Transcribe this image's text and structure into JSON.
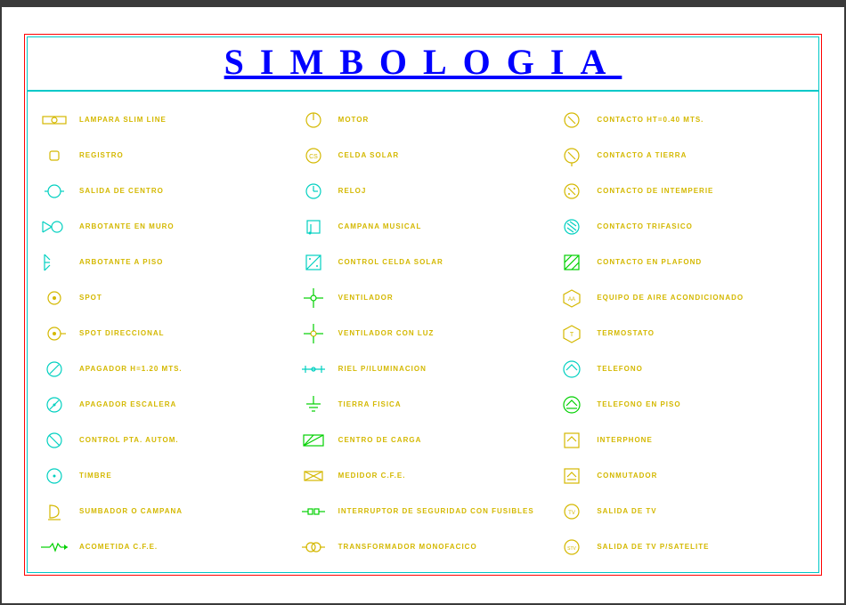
{
  "title": "SIMBOLOGIA",
  "columns": [
    [
      {
        "icon": "lamp-slim",
        "label": "LAMPARA SLIM LINE"
      },
      {
        "icon": "registro",
        "label": "REGISTRO"
      },
      {
        "icon": "salida-centro",
        "label": "SALIDA DE CENTRO"
      },
      {
        "icon": "arbotante-muro",
        "label": "ARBOTANTE EN MURO"
      },
      {
        "icon": "arbotante-piso",
        "label": "ARBOTANTE A PISO"
      },
      {
        "icon": "spot",
        "label": "SPOT"
      },
      {
        "icon": "spot-dir",
        "label": "SPOT DIRECCIONAL"
      },
      {
        "icon": "apagador",
        "label": "APAGADOR h=1.20 mts."
      },
      {
        "icon": "apagador-esc",
        "label": "APAGADOR ESCALERA"
      },
      {
        "icon": "control-pta",
        "label": "CONTROL PTA. AUTOM."
      },
      {
        "icon": "timbre",
        "label": "TIMBRE"
      },
      {
        "icon": "sumbador",
        "label": "SUMBADOR O CAMPANA"
      },
      {
        "icon": "acometida",
        "label": "ACOMETIDA C.F.E."
      }
    ],
    [
      {
        "icon": "motor",
        "label": "MOTOR"
      },
      {
        "icon": "celda-solar",
        "label": "CELDA SOLAR"
      },
      {
        "icon": "reloj",
        "label": "RELOJ"
      },
      {
        "icon": "campana-mus",
        "label": "CAMPANA MUSICAL"
      },
      {
        "icon": "control-celda",
        "label": "CONTROL CELDA SOLAR"
      },
      {
        "icon": "ventilador",
        "label": "VENTILADOR"
      },
      {
        "icon": "ventilador-luz",
        "label": "VENTILADOR CON LUZ"
      },
      {
        "icon": "riel",
        "label": "RIEL P/ILUMINACION"
      },
      {
        "icon": "tierra",
        "label": "TIERRA FISICA"
      },
      {
        "icon": "centro-carga",
        "label": "CENTRO DE CARGA"
      },
      {
        "icon": "medidor",
        "label": "MEDIDOR C.F.E."
      },
      {
        "icon": "interruptor",
        "label": "INTERRUPTOR DE SEGURIDAD CON FUSIBLES"
      },
      {
        "icon": "transformador",
        "label": "TRANSFORMADOR MONOFACICO"
      }
    ],
    [
      {
        "icon": "contacto-ht",
        "label": "CONTACTO HT=0.40 mts."
      },
      {
        "icon": "contacto-tierra",
        "label": "CONTACTO A TIERRA"
      },
      {
        "icon": "contacto-int",
        "label": "CONTACTO DE INTEMPERIE"
      },
      {
        "icon": "contacto-tri",
        "label": "CONTACTO TRIFASICO"
      },
      {
        "icon": "contacto-plaf",
        "label": "CONTACTO EN PLAFOND"
      },
      {
        "icon": "aire-ac",
        "label": "EQUIPO DE AIRE ACONDICIONADO"
      },
      {
        "icon": "termostato",
        "label": "TERMOSTATO"
      },
      {
        "icon": "telefono",
        "label": "TELEFONO"
      },
      {
        "icon": "telefono-piso",
        "label": "TELEFONO EN PISO"
      },
      {
        "icon": "interphone",
        "label": "INTERPHONE"
      },
      {
        "icon": "conmutador",
        "label": "CONMUTADOR"
      },
      {
        "icon": "salida-tv",
        "label": "SALIDA DE TV"
      },
      {
        "icon": "salida-tv-sat",
        "label": "SALIDA DE TV P/SATELITE"
      }
    ]
  ]
}
